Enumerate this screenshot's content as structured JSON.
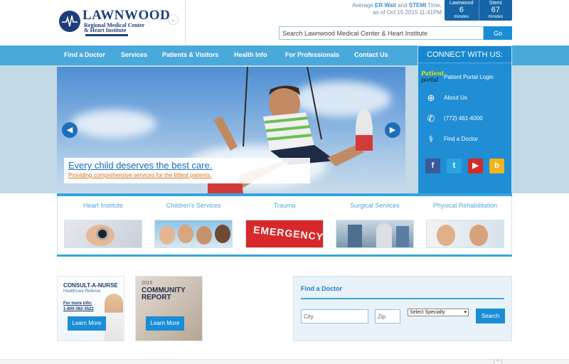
{
  "logo": {
    "name": "LAWNWOOD",
    "line1": "Regional Medical Center",
    "line2": "& Heart Institute"
  },
  "er_wait": {
    "text_prefix": "Average",
    "er_label": "ER Wait",
    "and": "and",
    "stemi_label": "STEMI",
    "text_suffix": "Time,",
    "as_of": "as of Oct 15 2015 11:41PM",
    "col1_label": "Lawnwood",
    "col1_value": "6",
    "col1_unit": "minutes",
    "col2_label": "Stemi",
    "col2_value": "67",
    "col2_unit": "minutes"
  },
  "search": {
    "placeholder": "Search Lawnwood Medical Center & Heart Institute",
    "button": "Go"
  },
  "nav": {
    "items": [
      "Find a Doctor",
      "Services",
      "Patients & Visitors",
      "Health Info",
      "For Professionals",
      "Contact Us"
    ]
  },
  "hero": {
    "title": "Every child deserves the best care.",
    "subtitle": "Providing comprehensive services for the littlest patients.",
    "prev_icon": "chevron-left-icon",
    "next_icon": "chevron-right-icon"
  },
  "connect": {
    "title": "CONNECT WITH US:",
    "portal_logo_line1": "Patient",
    "portal_logo_line2": "portal",
    "items": [
      {
        "label": "Patient Portal Login",
        "icon": "patient-portal-logo"
      },
      {
        "label": "About Us",
        "icon": "plus-circle-icon"
      },
      {
        "label": "(772) 461-4000",
        "icon": "phone-icon"
      },
      {
        "label": "Find a Doctor",
        "icon": "caduceus-icon"
      }
    ],
    "social": [
      "facebook-icon",
      "twitter-icon",
      "youtube-icon",
      "blog-icon"
    ]
  },
  "services": {
    "items": [
      "Heart Institute",
      "Children's Services",
      "Trauma",
      "Surgical Services",
      "Physical Rehabilitation"
    ],
    "emergency_sign": "EMERGENCY"
  },
  "promos": {
    "nurse": {
      "title": "CONSULT-A-NURSE",
      "subtitle": "Healthcare Referral",
      "info_label": "For more info:",
      "phone": "1-800-382-3522",
      "button": "Learn More"
    },
    "report": {
      "year": "2015",
      "line1": "COMMUNITY",
      "line2": "REPORT",
      "button": "Learn More"
    }
  },
  "find_doctor": {
    "title": "Find a Doctor",
    "city_placeholder": "City",
    "zip_placeholder": "Zip",
    "specialty": "Select Specialty",
    "button": "Search"
  },
  "colors": {
    "nav": "#4aa9db",
    "brand_dark": "#1d3e7a",
    "accent": "#1b8dd6"
  }
}
